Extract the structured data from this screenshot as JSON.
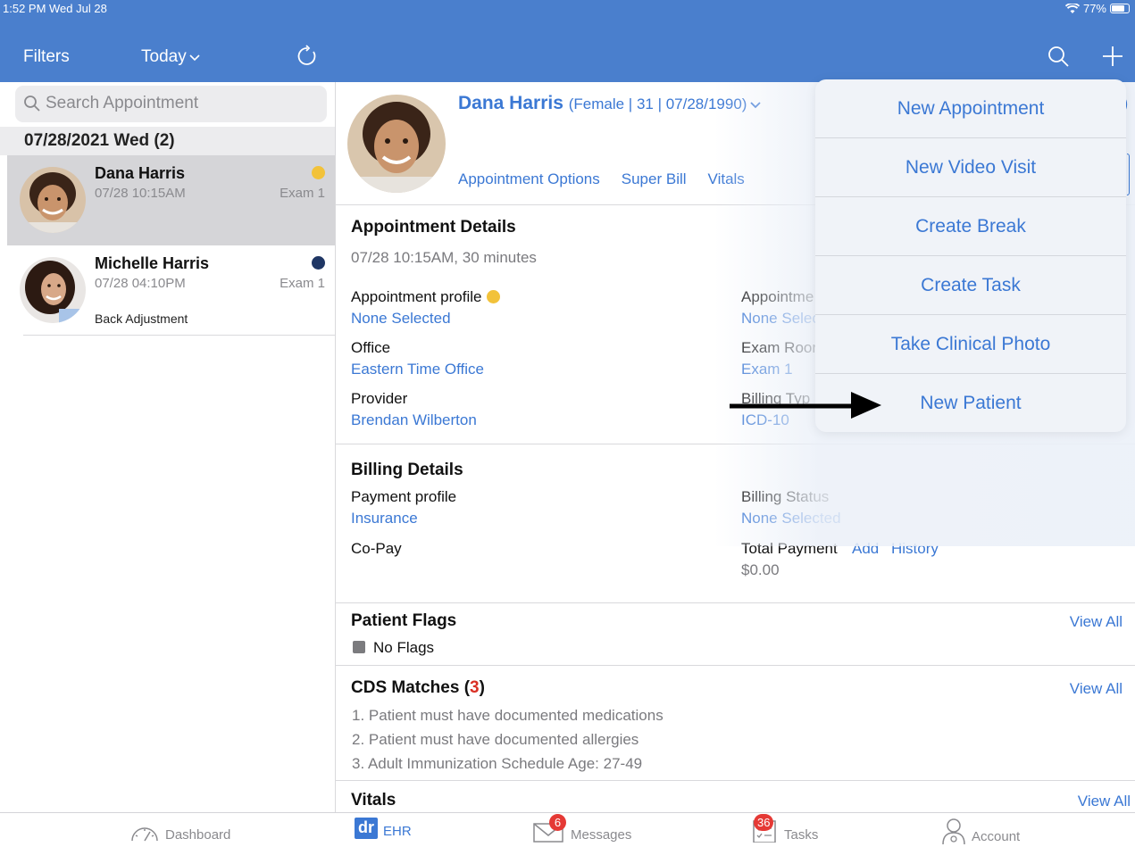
{
  "status_bar": {
    "time": "1:52 PM  Wed Jul 28",
    "battery": "77%"
  },
  "left_header": {
    "filters_label": "Filters",
    "date_filter_label": "Today"
  },
  "search": {
    "placeholder": "Search Appointment"
  },
  "date_group": {
    "label": "07/28/2021 Wed (2)"
  },
  "appointments": [
    {
      "name": "Dana Harris",
      "datetime": "07/28 10:15AM",
      "room": "Exam 1",
      "dot_color": "#f2c23a",
      "note": ""
    },
    {
      "name": "Michelle Harris",
      "datetime": "07/28 04:10PM",
      "room": "Exam 1",
      "dot_color": "#1f3664",
      "note": "Back Adjustment"
    }
  ],
  "patient": {
    "name": "Dana Harris",
    "meta": "(Female | 31 | 07/28/1990)",
    "options": [
      "Appointment Options",
      "Super Bill",
      "Vitals"
    ]
  },
  "appointment_details": {
    "title": "Appointment Details",
    "summary": "07/28 10:15AM, 30 minutes",
    "profile_label": "Appointment profile",
    "profile_value": "None Selected",
    "status_label": "Appointme",
    "status_value": "None Selec",
    "office_label": "Office",
    "office_value": "Eastern Time Office",
    "exam_label": "Exam Roor",
    "exam_value": "Exam 1",
    "provider_label": "Provider",
    "provider_value": "Brendan Wilberton",
    "billing_type_label": "Billing Typ",
    "billing_type_value": "ICD-10"
  },
  "billing_details": {
    "title": "Billing Details",
    "payment_profile_label": "Payment profile",
    "payment_profile_value": "Insurance",
    "billing_status_label": "Billing Status",
    "billing_status_value": "None Selected",
    "copay_label": "Co-Pay",
    "total_payment_label": "Total Payment",
    "add_label": "Add",
    "history_label": "History",
    "total_payment_value": "$0.00"
  },
  "patient_flags": {
    "title": "Patient Flags",
    "view_all": "View All",
    "no_flags": "No Flags"
  },
  "cds_matches": {
    "title_prefix": "CDS Matches (",
    "count": "3",
    "title_suffix": ")",
    "view_all": "View All",
    "items": [
      "1. Patient must have documented medications",
      "2. Patient must have documented allergies",
      "3. Adult Immunization Schedule Age: 27-49"
    ]
  },
  "vitals": {
    "title": "Vitals",
    "view_all": "View All"
  },
  "add_menu": {
    "items": [
      "New Appointment",
      "New Video Visit",
      "Create Break",
      "Create Task",
      "Take Clinical Photo",
      "New Patient"
    ]
  },
  "tab_bar": {
    "dashboard": "Dashboard",
    "ehr": "EHR",
    "ehr_logo": "dr",
    "messages": "Messages",
    "messages_badge": "6",
    "tasks": "Tasks",
    "tasks_badge": "36",
    "account": "Account"
  },
  "colors": {
    "header_blue": "#4a7fcd",
    "link_blue": "#3b78d4",
    "badge_red": "#e53935"
  }
}
